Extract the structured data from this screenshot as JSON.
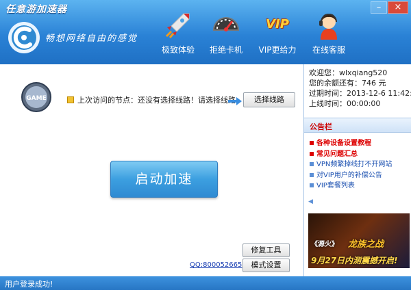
{
  "window": {
    "title": "任意游加速器",
    "slogan": "畅想网络自由的感觉",
    "controls": {
      "minimize": "–",
      "close": "×"
    }
  },
  "nav": [
    {
      "label": "极致体验",
      "icon": "rocket-icon"
    },
    {
      "label": "拒绝卡机",
      "icon": "speedometer-icon"
    },
    {
      "label": "VIP更给力",
      "icon": "vip-icon",
      "badge": "VIP"
    },
    {
      "label": "在线客服",
      "icon": "support-agent-icon"
    }
  ],
  "main": {
    "game_badge": "GAME",
    "last_node_text": "上次访问的节点：还没有选择线路！请选择线路",
    "select_line_button": "选择线路",
    "start_button": "启动加速",
    "qq_link": "QQ:800052665",
    "repair_tool_button": "修复工具",
    "mode_settings_button": "模式设置"
  },
  "user": {
    "welcome_label": "欢迎您：",
    "username": "wlxqiang520",
    "balance_label": "您的余额还有：",
    "balance_value": "746 元",
    "expire_label": "过期时间：",
    "expire_value": "2013-12-6 11:42:26",
    "lastlogin_label": "上线时间：",
    "lastlogin_value": "00:00:00"
  },
  "announcements": {
    "header": "公告栏",
    "items": [
      {
        "text": "各种设备设置教程",
        "style": "red"
      },
      {
        "text": "常见问题汇总",
        "style": "red"
      },
      {
        "text": "VPN频繁掉线打不开网站",
        "style": "blue"
      },
      {
        "text": "对VIP用户的补偿公告",
        "style": "blue"
      },
      {
        "text": "VIP套餐列表",
        "style": "blue"
      }
    ]
  },
  "banner": {
    "game_title": "《源火》",
    "headline": "龙族之战",
    "date_text": "9月27日内测震撼开启!"
  },
  "status": {
    "text": "用户登录成功!"
  },
  "colors": {
    "title_bar": "#2a82d6",
    "status_bar": "#2776c4",
    "accent_red": "#d00",
    "link_blue": "#1a4fb0"
  }
}
